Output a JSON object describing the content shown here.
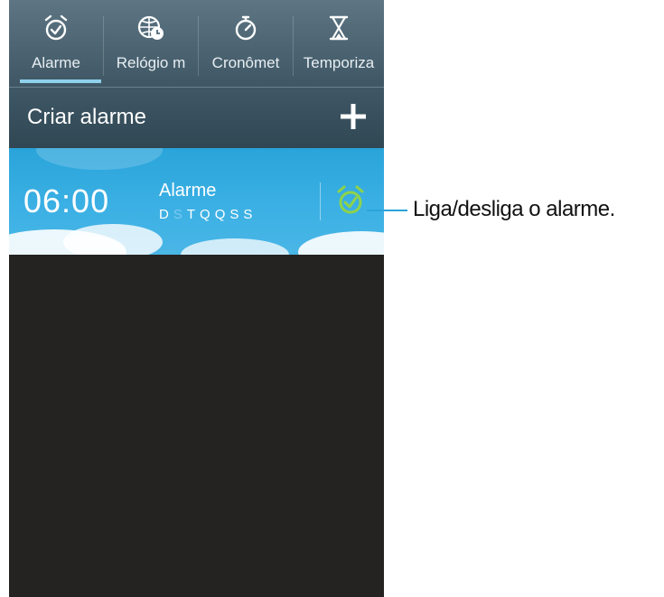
{
  "tabs": [
    {
      "label": "Alarme",
      "icon": "alarm-clock-icon",
      "selected": true
    },
    {
      "label": "Relógio m",
      "icon": "world-clock-icon",
      "selected": false
    },
    {
      "label": "Cronômet",
      "icon": "stopwatch-icon",
      "selected": false
    },
    {
      "label": "Temporiza",
      "icon": "hourglass-icon",
      "selected": false
    }
  ],
  "header": {
    "title": "Criar alarme",
    "add_icon": "plus-icon"
  },
  "alarm": {
    "time": "06:00",
    "label": "Alarme",
    "days": [
      {
        "letter": "D",
        "active": true
      },
      {
        "letter": "S",
        "active": false
      },
      {
        "letter": "T",
        "active": true
      },
      {
        "letter": "Q",
        "active": true
      },
      {
        "letter": "Q",
        "active": true
      },
      {
        "letter": "S",
        "active": true
      },
      {
        "letter": "S",
        "active": true
      }
    ],
    "toggle_icon": "alarm-on-icon",
    "toggle_color": "#8ed34a"
  },
  "callout": {
    "text": "Liga/desliga o alarme."
  },
  "colors": {
    "tab_bar": "#4f6775",
    "tab_underline": "#8fd0ea",
    "alarm_row": "#2aa4da",
    "body_bg": "#252222"
  }
}
